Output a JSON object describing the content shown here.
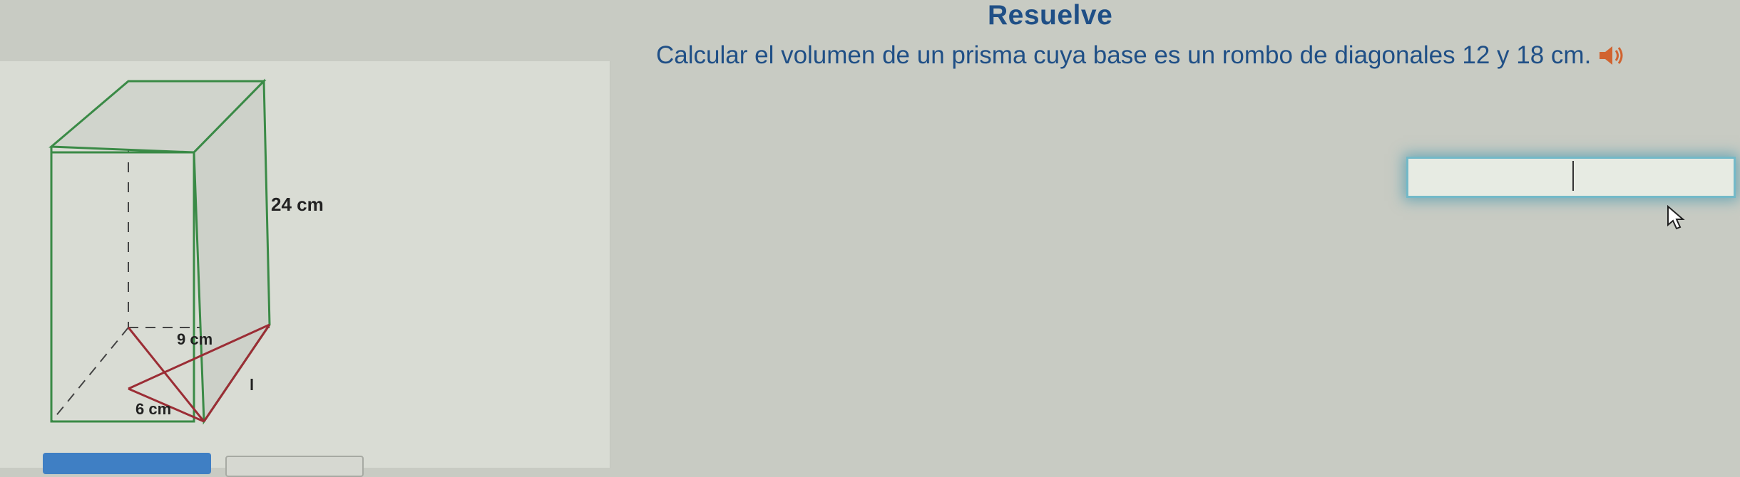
{
  "header": {
    "title": "Resuelve"
  },
  "problem": {
    "text": "Calcular el volumen de un prisma cuya base es un rombo de diagonales 12 y 18 cm."
  },
  "figure": {
    "height_label": "24 cm",
    "half_diagonal_long_label": "9 cm",
    "half_diagonal_short_label": "6 cm",
    "side_label": "l"
  },
  "answer": {
    "value": ""
  },
  "icons": {
    "speaker": "speaker-icon",
    "cursor": "cursor-icon"
  },
  "colors": {
    "text_accent": "#1f4f86",
    "edge_green": "#3a8a46",
    "diagonal_red": "#9b2d35",
    "input_glow": "#73b9c8"
  }
}
